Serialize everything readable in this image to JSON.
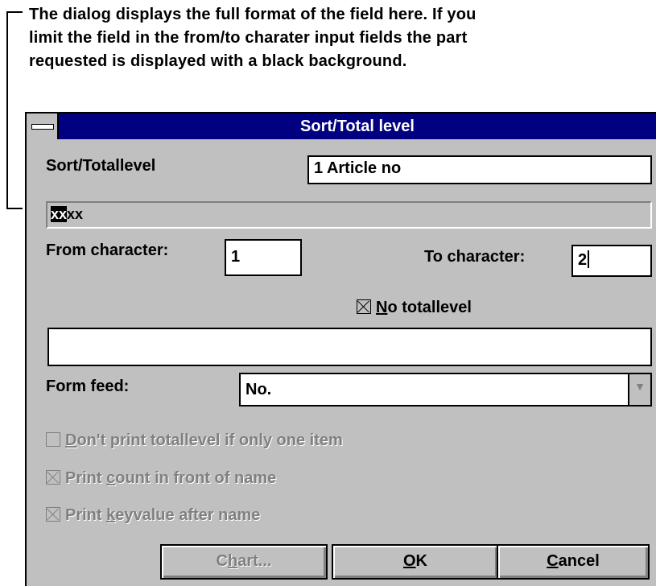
{
  "annotation": {
    "line1": "The dialog displays the full format of the field here. If you",
    "line2": "limit the field in the from/to charater input fields the part",
    "line3": "requested is displayed with a black background."
  },
  "dialog": {
    "title": "Sort/Total level",
    "sort_label": "Sort/Totallevel",
    "sort_value": "1 Article no",
    "format_highlight": "xx",
    "format_rest": "xx",
    "from_label": "From character:",
    "from_value": "1",
    "to_label": "To character:",
    "to_value": "2",
    "no_totallevel": {
      "accel": "N",
      "rest": "o totallevel",
      "checked": true
    },
    "blank_field_value": "",
    "form_feed_label": "Form feed:",
    "form_feed_value": "No.",
    "checkbox_dont_print": {
      "pre": "",
      "accel": "D",
      "rest": "on't print totallevel if only one item",
      "checked": false
    },
    "checkbox_print_count": {
      "pre": "Print ",
      "accel": "c",
      "rest": "ount in front of name",
      "checked": true
    },
    "checkbox_print_key": {
      "pre": "Print ",
      "accel": "k",
      "rest": "eyvalue after name",
      "checked": true
    },
    "buttons": {
      "chart": {
        "pre": "C",
        "accel": "h",
        "rest": "art..."
      },
      "ok": {
        "pre": "",
        "accel": "O",
        "rest": "K"
      },
      "cancel": {
        "pre": "",
        "accel": "C",
        "rest": "ancel"
      }
    }
  }
}
